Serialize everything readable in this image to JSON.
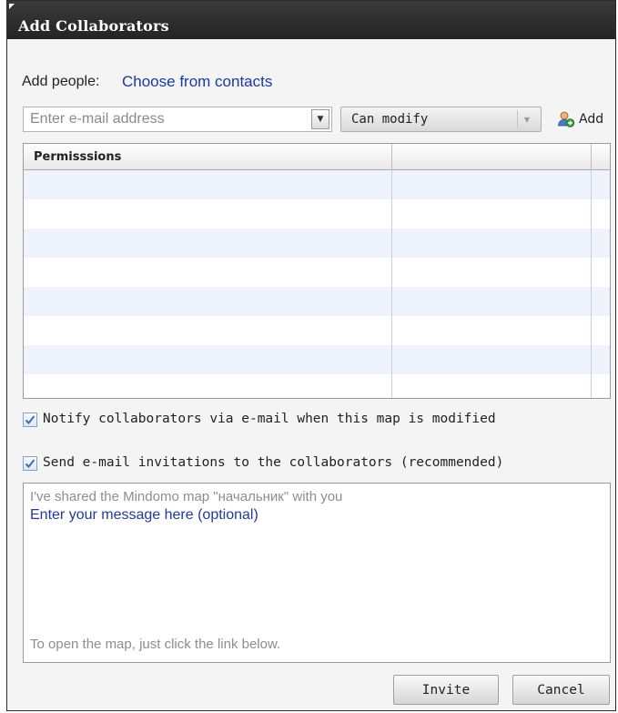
{
  "dialog": {
    "title": "Add Collaborators"
  },
  "add_people": {
    "label": "Add people:",
    "choose_link": "Choose from contacts"
  },
  "email": {
    "placeholder": "Enter e-mail address",
    "value": ""
  },
  "permission_select": {
    "selected": "Can modify"
  },
  "add_button": {
    "label": "Add",
    "icon": "add-user-icon"
  },
  "grid": {
    "columns": [
      "Permisssions",
      "",
      ""
    ],
    "rows": [
      "",
      "",
      "",
      "",
      "",
      "",
      "",
      ""
    ]
  },
  "options": {
    "notify": {
      "label": "Notify collaborators via e-mail when this map is modified",
      "checked": true
    },
    "invite": {
      "label": "Send e-mail invitations to the collaborators (recommended)",
      "checked": true
    }
  },
  "message": {
    "intro": "I've shared the Mindomo map \"начальник\" with you",
    "placeholder": "Enter your message here (optional)",
    "footer": "To open the map, just click the link below."
  },
  "buttons": {
    "invite": "Invite",
    "cancel": "Cancel"
  },
  "colors": {
    "title_bar": "#2e2e2e",
    "link": "#1a3aa0",
    "row_alt": "#eef3fc"
  }
}
